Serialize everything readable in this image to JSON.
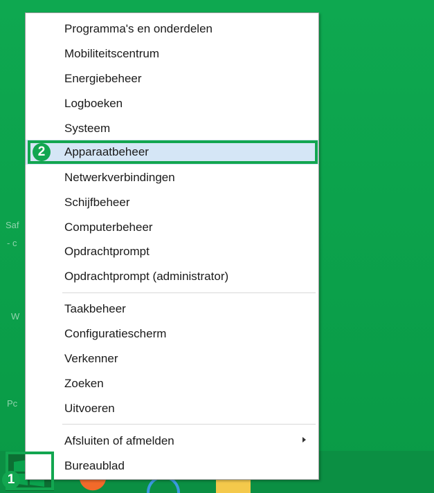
{
  "menu": {
    "items": [
      {
        "label": "Programma's en onderdelen"
      },
      {
        "label": "Mobiliteitscentrum"
      },
      {
        "label": "Energiebeheer"
      },
      {
        "label": "Logboeken"
      },
      {
        "label": "Systeem"
      },
      {
        "label": "Apparaatbeheer",
        "selected": true
      },
      {
        "label": "Netwerkverbindingen"
      },
      {
        "label": "Schijfbeheer"
      },
      {
        "label": "Computerbeheer"
      },
      {
        "label": "Opdrachtprompt"
      },
      {
        "label": "Opdrachtprompt (administrator)"
      },
      {
        "label": "Taakbeheer"
      },
      {
        "label": "Configuratiescherm"
      },
      {
        "label": "Verkenner"
      },
      {
        "label": "Zoeken"
      },
      {
        "label": "Uitvoeren"
      },
      {
        "label": "Afsluiten of afmelden",
        "has_submenu": true
      },
      {
        "label": "Bureaublad"
      }
    ]
  },
  "annotations": {
    "step1": "1",
    "step2": "2"
  },
  "desktop": {
    "ghost_text_1": "Saf",
    "ghost_text_2": "- c",
    "ghost_text_3": "W",
    "ghost_text_4": "Pc"
  },
  "colors": {
    "desktop": "#0aa34d",
    "highlight": "#d5e6f6",
    "callout": "#12a650"
  }
}
